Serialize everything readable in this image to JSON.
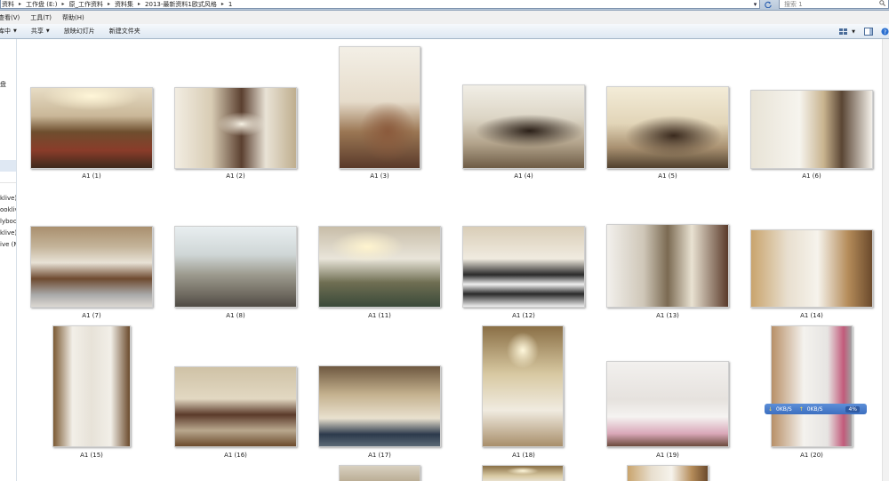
{
  "address_bar": {
    "crumbs": [
      "资料",
      "工作盘 (E:)",
      "原_工作资料",
      "资料集",
      "2013-最新资料1欧式风格",
      "1"
    ],
    "search_placeholder": "搜索 1"
  },
  "menu": [
    "查看(V)",
    "工具(T)",
    "帮助(H)"
  ],
  "toolbar": {
    "buttons": [
      {
        "label": "库中",
        "dropdown": true
      },
      {
        "label": "共享",
        "dropdown": true
      },
      {
        "label": "放映幻灯片",
        "dropdown": false
      },
      {
        "label": "新建文件夹",
        "dropdown": false
      }
    ]
  },
  "nav": {
    "items": [
      "盘",
      "klive)",
      "ooklive",
      "lyboo",
      "klive)",
      "ive (M"
    ]
  },
  "files": [
    {
      "name": "A1 (1)",
      "style": "p-living"
    },
    {
      "name": "A1 (2)",
      "style": "p-living2"
    },
    {
      "name": "A1 (3)",
      "style": "p-chair"
    },
    {
      "name": "A1 (4)",
      "style": "p-dining"
    },
    {
      "name": "A1 (5)",
      "style": "p-dining2"
    },
    {
      "name": "A1 (6)",
      "style": "p-shelf"
    },
    {
      "name": "A1 (7)",
      "style": "p-kitchen"
    },
    {
      "name": "A1 (8)",
      "style": "p-lounge"
    },
    {
      "name": "A1 (11)",
      "style": "p-bed"
    },
    {
      "name": "A1 (12)",
      "style": "p-checker"
    },
    {
      "name": "A1 (13)",
      "style": "p-study"
    },
    {
      "name": "A1 (14)",
      "style": "p-study2"
    },
    {
      "name": "A1 (15)",
      "style": "p-cabinet"
    },
    {
      "name": "A1 (16)",
      "style": "p-bedroom"
    },
    {
      "name": "A1 (17)",
      "style": "p-bath"
    },
    {
      "name": "A1 (18)",
      "style": "p-bathtub"
    },
    {
      "name": "A1 (19)",
      "style": "p-kidsroom"
    },
    {
      "name": "A1 (20)",
      "style": "p-dressing"
    }
  ],
  "speed_widget": {
    "down": "0KB/S",
    "up": "0KB/S",
    "percent": "4%"
  }
}
